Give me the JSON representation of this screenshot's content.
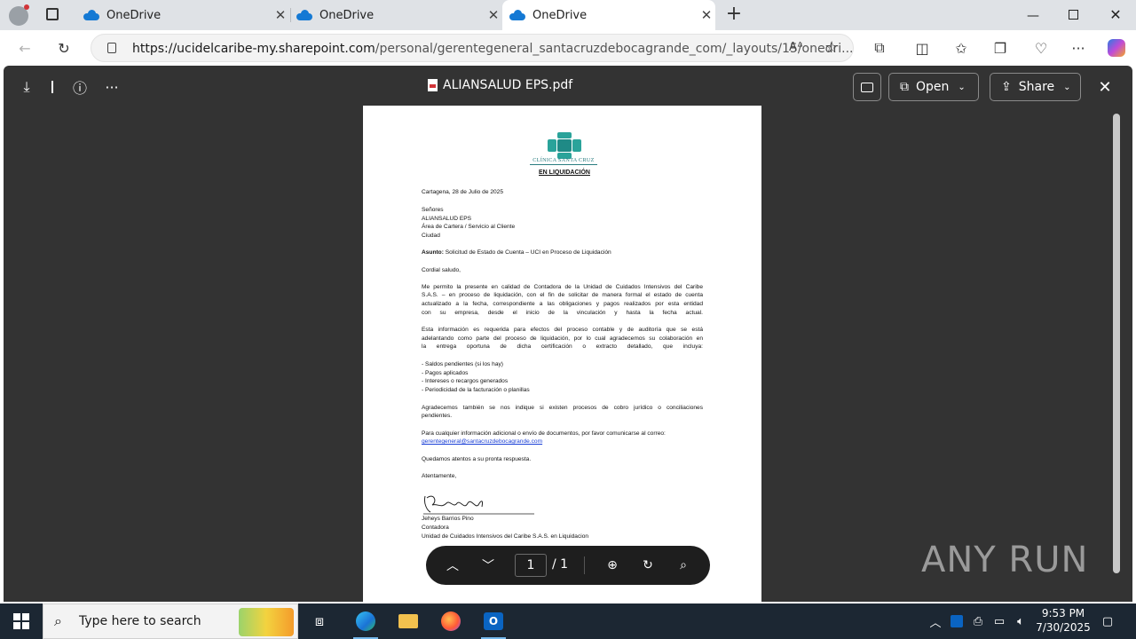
{
  "browser": {
    "tabs": [
      {
        "label": "OneDrive"
      },
      {
        "label": "OneDrive"
      },
      {
        "label": "OneDrive"
      }
    ],
    "new_tab_label": "+",
    "url_host": "https://ucidelcaribe-my.sharepoint.com",
    "url_path": "/personal/gerentegeneral_santacruzdebocagrande_com/_layouts/15/onedri..."
  },
  "viewer": {
    "filename": "ALIANSALUD EPS.pdf",
    "open_label": "Open",
    "share_label": "Share",
    "page_current": "1",
    "page_total": "/ 1"
  },
  "document": {
    "clinic_name": "CLÍNICA SANTA CRUZ",
    "status_heading": "EN LIQUIDACIÓN",
    "date_line": "Cartagena, 28 de Julio de 2025",
    "recipient": [
      "Señores",
      "ALIANSALUD EPS",
      "Área de Cartera / Servicio al Cliente",
      "Ciudad"
    ],
    "subject_label": "Asunto:",
    "subject_text": " Solicitud de Estado de Cuenta – UCI en Proceso de Liquidación",
    "greeting": "Cordial saludo,",
    "para1": [
      "Me permito la presente en calidad de Contadora de la Unidad de Cuidados Intensivos del Caribe",
      "S.A.S. – en proceso de liquidación, con el fin de solicitar de manera formal el estado de cuenta",
      "actualizado a la fecha, correspondiente a las obligaciones y pagos realizados por esta entidad",
      "con su empresa, desde el inicio de la vinculación y hasta la fecha actual."
    ],
    "para2": [
      "Esta información es requerida para efectos del proceso contable y de auditoría que se está",
      "adelantando como parte del proceso de liquidación, por lo cual agradecemos su colaboración en",
      "la entrega oportuna de dicha certificación o extracto detallado, que incluya:"
    ],
    "bullets": [
      "- Saldos pendientes (si los hay)",
      "- Pagos aplicados",
      "- Intereses o recargos generados",
      "- Periodicidad de la facturación o planillas"
    ],
    "para3": [
      "Agradecemos también se nos indique si existen procesos de cobro jurídico o conciliaciones",
      "pendientes."
    ],
    "para4": "Para cualquier información adicional o envío de documentos, por favor comunicarse al correo:",
    "email": "gerentegeneral@santacruzdebocagrande.com",
    "closing1": "Quedamos atentos a su pronta respuesta.",
    "closing2": "Atentamente,",
    "signer_name": "Jeheys Barrios Pino",
    "signer_role": "Contadora",
    "signer_org": "Unidad de Cuidados Intensivos del Caribe S.A.S. en Liquidacion"
  },
  "watermark": "ANY RUN",
  "taskbar": {
    "search_placeholder": "Type here to search",
    "time": "9:53 PM",
    "date": "7/30/2025"
  }
}
